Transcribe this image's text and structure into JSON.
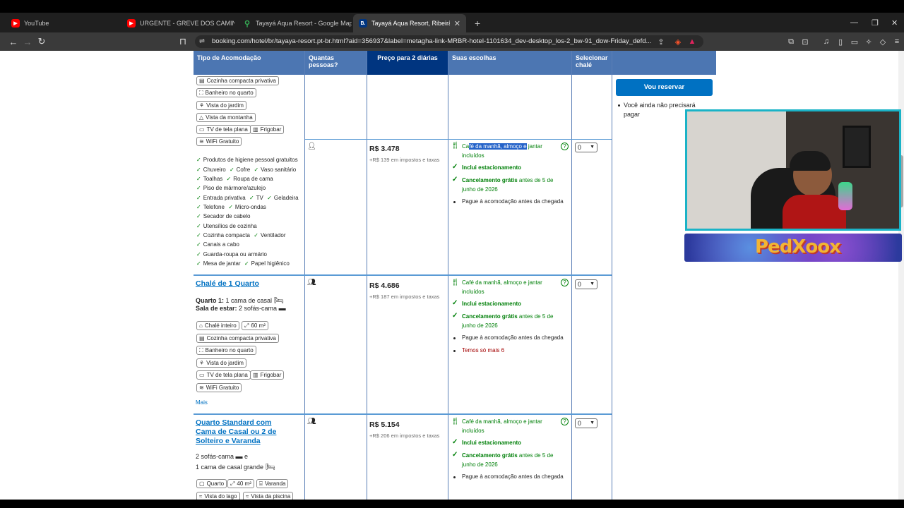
{
  "tabs": [
    {
      "title": "YouTube",
      "color": "#ff0000"
    },
    {
      "title": "URGENTE - GREVE DOS CAMINHONE",
      "color": "#ff0000"
    },
    {
      "title": "Tayayá Aqua Resort - Google Maps",
      "color": "#34a853"
    },
    {
      "title": "Tayayá Aqua Resort, Ribeirão Cla",
      "color": "#003580",
      "active": true
    }
  ],
  "url": "booking.com/hotel/br/tayaya-resort.pt-br.html?aid=356937&label=metagha-link-MRBR-hotel-1101634_dev-desktop_los-2_bw-91_dow-Friday_defd...",
  "table_headers": {
    "type": "Tipo de Acomodação",
    "people": "Quantas pessoas?",
    "price": "Preço para 2 diárias",
    "choices": "Suas escolhas",
    "select": "Selecionar chalé"
  },
  "row0": {
    "chips": [
      "Cozinha compacta privativa",
      "Banheiro no quarto",
      "Vista do jardim",
      "Vista da montanha",
      "TV de tela plana",
      "Frigobar",
      "WiFi Gratuito"
    ],
    "features": [
      [
        "Produtos de higiene pessoal gratuitos"
      ],
      [
        "Chuveiro",
        "Cofre",
        "Vaso sanitário"
      ],
      [
        "Toalhas",
        "Roupa de cama"
      ],
      [
        "Piso de mármore/azulejo"
      ],
      [
        "Entrada privativa",
        "TV",
        "Geladeira"
      ],
      [
        "Telefone",
        "Micro-ondas"
      ],
      [
        "Secador de cabelo"
      ],
      [
        "Utensílios de cozinha"
      ],
      [
        "Cozinha compacta",
        "Ventilador"
      ],
      [
        "Canais a cabo"
      ],
      [
        "Guarda-roupa ou armário"
      ],
      [
        "Mesa de jantar",
        "Papel higiênico"
      ]
    ],
    "option": {
      "price": "R$ 3.478",
      "tax": "+R$ 139 em impostos e taxas",
      "meal_pre": "Ca",
      "meal_hl": "fé da manhã, almoço e",
      "meal_post": " jantar",
      "meal_line2": "incluídos",
      "parking": "Inclui estacionamento",
      "cancel_bold": "Cancelamento grátis",
      "cancel_rest": " antes de 5 de",
      "cancel_line2": "junho de 2026",
      "pay": "Pague à acomodação antes da chegada",
      "qty": "0"
    }
  },
  "reserve_button": "Vou reservar",
  "reserve_note_line1": "Você ainda não precisará",
  "reserve_note_line2": "pagar",
  "row1": {
    "title": "Chalé de 1 Quarto",
    "bed1_label": "Quarto 1:",
    "bed1_text": " 1 cama de casal",
    "bed2_label": "Sala de estar:",
    "bed2_text": " 2 sofás-cama",
    "chips": [
      "Chalé inteiro",
      "60 m²",
      "Cozinha compacta privativa",
      "Banheiro no quarto",
      "Vista do jardim",
      "TV de tela plana",
      "Frigobar",
      "WiFi Gratuito"
    ],
    "more": "Mais",
    "price": "R$ 4.686",
    "tax": "+R$ 187 em impostos e taxas",
    "meal": "Café da manhã, almoço e jantar",
    "meal_line2": "incluídos",
    "parking": "Inclui estacionamento",
    "cancel_bold": "Cancelamento grátis",
    "cancel_rest": " antes de 5 de",
    "cancel_line2": "junho de 2026",
    "pay": "Pague à acomodação antes da chegada",
    "scarcity": "Temos só mais 6",
    "qty": "0"
  },
  "row2": {
    "title_l1": "Quarto Standard com",
    "title_l2": "Cama de Casal ou 2 de",
    "title_l3": "Solteiro e Varanda",
    "bed1": "2 sofás-cama",
    "bed_and": " e",
    "bed2": "1 cama de casal grande",
    "chips": [
      "Quarto",
      "40 m²",
      "Varanda",
      "Vista do lago",
      "Vista da piscina"
    ],
    "price": "R$ 5.154",
    "tax": "+R$ 206 em impostos e taxas",
    "meal": "Café da manhã, almoço e jantar",
    "meal_line2": "incluídos",
    "parking": "Inclui estacionamento",
    "cancel_bold": "Cancelamento grátis",
    "cancel_rest": " antes de 5 de",
    "cancel_line2": "junho de 2026",
    "pay": "Pague à acomodação antes da chegada",
    "qty": "0"
  }
}
